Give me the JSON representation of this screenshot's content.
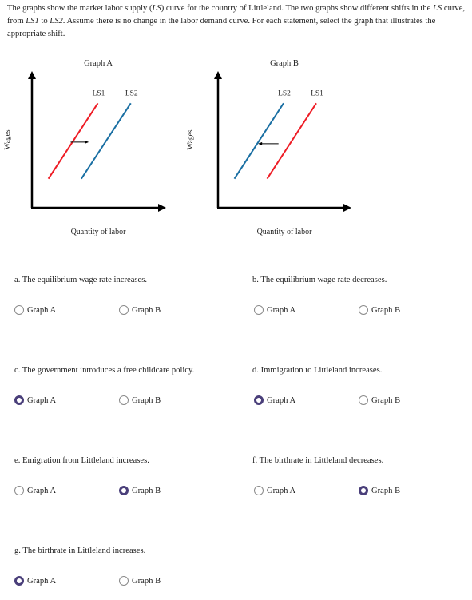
{
  "intro": {
    "part1": "The graphs show the market labor supply (",
    "ls_italic": "LS",
    "part2": ") curve for the country of Littleland. The two graphs show different shifts in the ",
    "ls_italic2": "LS",
    "part3": " curve, from ",
    "ls1_italic": "LS1",
    "part4": " to ",
    "ls2_italic": "LS2",
    "part5": ". Assume there is no change in the labor demand curve. For each statement, select the graph that illustrates the appropriate shift."
  },
  "colors": {
    "ls1": "#ee1c25",
    "ls2": "#1a6fa3",
    "axis": "#000000",
    "radio_selected": "#4a3f7a"
  },
  "chart_data": [
    {
      "type": "line",
      "title": "Graph A",
      "xlabel": "Quantity of labor",
      "ylabel": "Wages",
      "series": [
        {
          "name": "LS1",
          "color": "#ee1c25",
          "points": [
            [
              1,
              1
            ],
            [
              4,
              6
            ]
          ]
        },
        {
          "name": "LS2",
          "color": "#1a6fa3",
          "points": [
            [
              3,
              1
            ],
            [
              6,
              6
            ]
          ]
        }
      ],
      "shift_arrow": "right",
      "xlim": [
        0,
        8
      ],
      "ylim": [
        -1,
        8
      ]
    },
    {
      "type": "line",
      "title": "Graph B",
      "xlabel": "Quantity of labor",
      "ylabel": "Wages",
      "series": [
        {
          "name": "LS2",
          "color": "#1a6fa3",
          "points": [
            [
              1,
              1
            ],
            [
              4,
              6
            ]
          ]
        },
        {
          "name": "LS1",
          "color": "#ee1c25",
          "points": [
            [
              3,
              1
            ],
            [
              6,
              6
            ]
          ]
        }
      ],
      "shift_arrow": "left",
      "xlim": [
        0,
        8
      ],
      "ylim": [
        -1,
        8
      ]
    }
  ],
  "questions": [
    {
      "label": "a. The equilibrium wage rate increases.",
      "options": [
        "Graph A",
        "Graph B"
      ],
      "selected": null
    },
    {
      "label": "b. The equilibrium wage rate decreases.",
      "options": [
        "Graph A",
        "Graph B"
      ],
      "selected": null
    },
    {
      "label": "c. The government introduces a free childcare policy.",
      "options": [
        "Graph A",
        "Graph B"
      ],
      "selected": "Graph A"
    },
    {
      "label": "d. Immigration to Littleland increases.",
      "options": [
        "Graph A",
        "Graph B"
      ],
      "selected": "Graph A"
    },
    {
      "label": "e. Emigration from Littleland increases.",
      "options": [
        "Graph A",
        "Graph B"
      ],
      "selected": "Graph B"
    },
    {
      "label": "f. The birthrate in Littleland decreases.",
      "options": [
        "Graph A",
        "Graph B"
      ],
      "selected": "Graph B"
    },
    {
      "label": "g. The birthrate in Littleland increases.",
      "options": [
        "Graph A",
        "Graph B"
      ],
      "selected": "Graph A"
    }
  ]
}
